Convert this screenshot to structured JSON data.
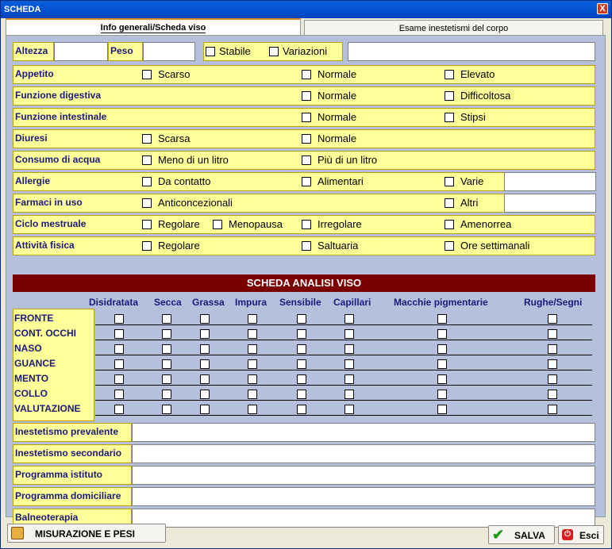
{
  "window": {
    "title": "SCHEDA",
    "close_label": "X"
  },
  "tabs": [
    {
      "label": "Info generali/Scheda viso"
    },
    {
      "label": "Esame inestetismi del corpo"
    }
  ],
  "top_row": {
    "altezza_label": "Altezza",
    "altezza_value": "",
    "peso_label": "Peso",
    "peso_value": "",
    "stabile_label": "Stabile",
    "variazioni_label": "Variazioni",
    "variazioni_value": ""
  },
  "rows": [
    {
      "label": "Appetito",
      "options": [
        "Scarso",
        "Normale",
        "Elevato"
      ]
    },
    {
      "label": "Funzione digestiva",
      "options": [
        "",
        "Normale",
        "Difficoltosa"
      ]
    },
    {
      "label": "Funzione intestinale",
      "options": [
        "",
        "Normale",
        "Stipsi"
      ]
    },
    {
      "label": "Diuresi",
      "options": [
        "Scarsa",
        "Normale",
        ""
      ]
    },
    {
      "label": "Consumo di acqua",
      "options": [
        "Meno di un litro",
        "Più di un litro",
        ""
      ]
    },
    {
      "label": "Allergie",
      "options": [
        "Da contatto",
        "Alimentari",
        "Varie"
      ]
    },
    {
      "label": "Farmaci in uso",
      "options": [
        "Anticoncezionali",
        "",
        "Altri"
      ]
    },
    {
      "label": "Ciclo mestruale",
      "options": [
        "Regolare",
        "Menopausa",
        "Irregolare",
        "Amenorrea"
      ]
    },
    {
      "label": "Attività fisica",
      "options": [
        "Regolare",
        "Saltuaria",
        "Ore settimanali"
      ]
    }
  ],
  "analisi": {
    "title": "SCHEDA ANALISI VISO",
    "columns": [
      "Disidratata",
      "Secca",
      "Grassa",
      "Impura",
      "Sensibile",
      "Capillari",
      "Macchie pigmentarie",
      "Rughe/Segni"
    ],
    "rows": [
      "FRONTE",
      "CONT. OCCHI",
      "NASO",
      "GUANCE",
      "MENTO",
      "COLLO",
      "VALUTAZIONE"
    ]
  },
  "bottom_fields": [
    {
      "label": "Inestetismo prevalente",
      "value": ""
    },
    {
      "label": "Inestetismo secondario",
      "value": ""
    },
    {
      "label": "Programma istituto",
      "value": ""
    },
    {
      "label": "Programma domiciliare",
      "value": ""
    },
    {
      "label": "Balneoterapia",
      "value": ""
    }
  ],
  "buttons": {
    "misurazione": "MISURAZIONE E PESI",
    "salva": "SALVA",
    "esci": "Esci"
  },
  "colors": {
    "label_bg": "#ffff99",
    "header_bg": "#7a0000",
    "panel_bg": "#b4c0dc",
    "title_bar": "#0054e3"
  }
}
